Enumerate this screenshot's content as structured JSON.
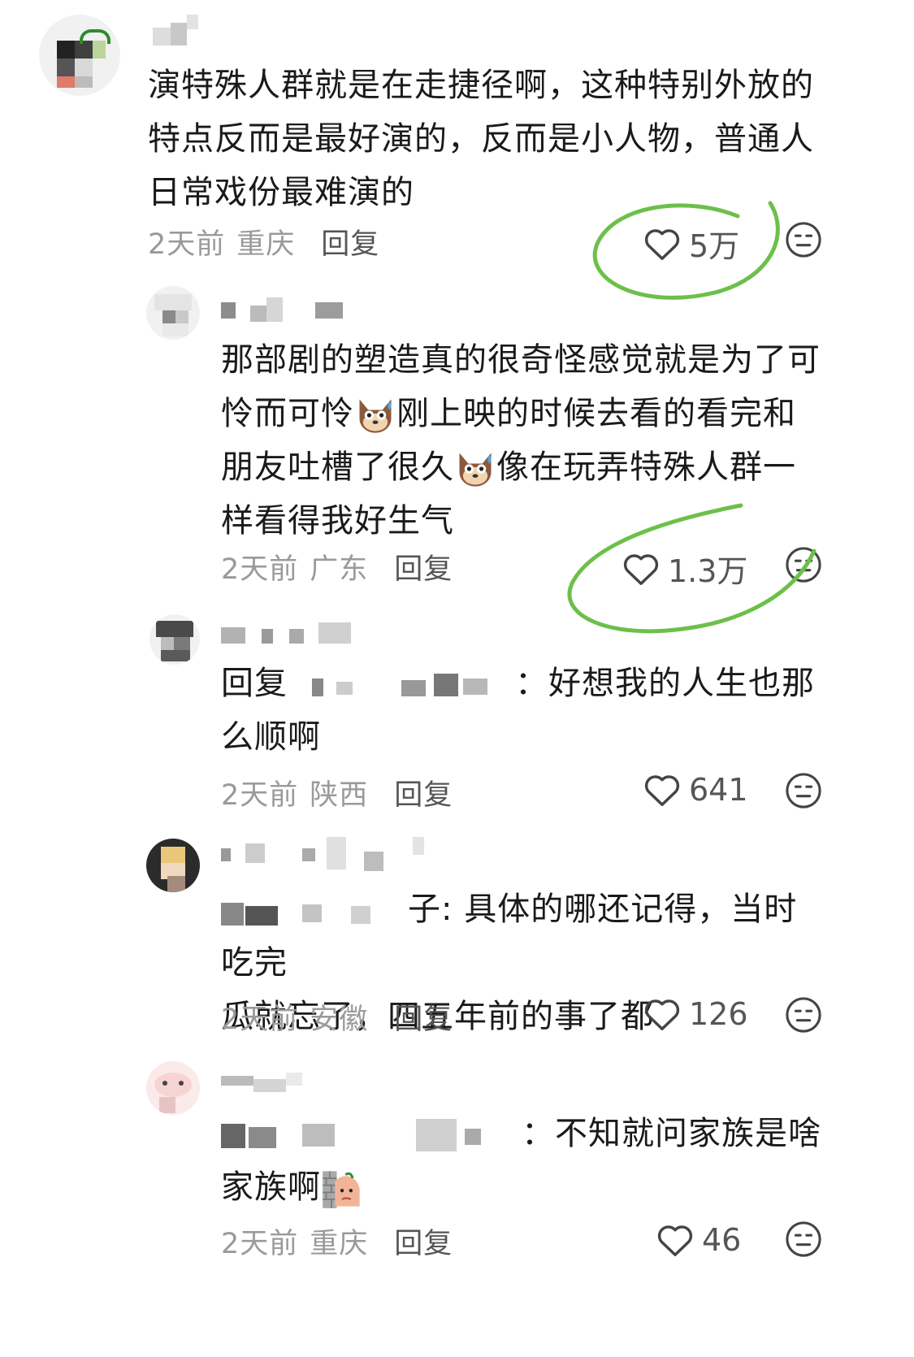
{
  "comments": [
    {
      "text": "演特殊人群就是在走捷径啊，这种特别外放的特点反而是最好演的，反而是小人物，普通人日常戏份最难演的",
      "time": "2天前",
      "location": "重庆",
      "reply_label": "回复",
      "likes": "5万",
      "icon_like": "heart-outline-icon",
      "icon_dislike": "meh-face-icon"
    },
    {
      "text_parts": [
        "那部剧的塑造真的很奇怪感觉就是为了可怜而可怜",
        "刚上映的时候去看的看完和朋友吐槽了很久",
        "像在玩弄特殊人群一样看得我好生气"
      ],
      "emoji": "dog-sweat-emoji",
      "time": "2天前",
      "location": "广东",
      "reply_label": "回复",
      "likes": "1.3万"
    },
    {
      "prefix": "回复",
      "text": "：好想我的人生也那么顺啊",
      "time": "2天前",
      "location": "陕西",
      "reply_label": "回复",
      "likes": "641"
    },
    {
      "text_a": "子: 具体的哪还记得，当时吃完",
      "text_b": "瓜就忘了，四五年前的事了都",
      "time": "2天前",
      "location": "安徽",
      "reply_label": "回复",
      "likes": "126"
    },
    {
      "text_a": "：不知就问家族是啥",
      "text_b": "家族啊",
      "emoji": "peeking-wall-emoji",
      "time": "2天前",
      "location": "重庆",
      "reply_label": "回复",
      "likes": "46"
    }
  ],
  "colors": {
    "annotation_circle": "#6cc04a",
    "meta": "#9a9a9a",
    "text": "#1a1a1a"
  }
}
